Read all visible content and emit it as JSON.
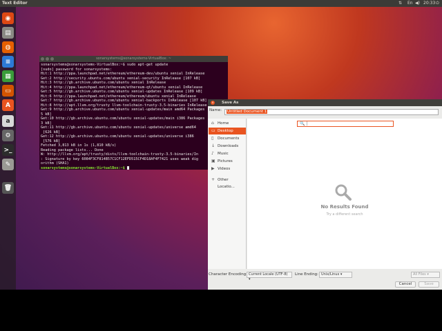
{
  "topbar": {
    "app_title": "Text Editor",
    "lang": "En",
    "time": "20:33"
  },
  "launcher": {
    "items": [
      {
        "icon": "ubuntu-dash-icon",
        "color": "#dd4814",
        "glyph": "◉"
      },
      {
        "icon": "files-icon",
        "color": "#8a8a84",
        "glyph": "▤"
      },
      {
        "icon": "firefox-icon",
        "color": "#e66000",
        "glyph": "◍"
      },
      {
        "icon": "writer-icon",
        "color": "#2c7ad6",
        "glyph": "≡"
      },
      {
        "icon": "calc-icon",
        "color": "#3a9d3a",
        "glyph": "▦"
      },
      {
        "icon": "impress-icon",
        "color": "#d35400",
        "glyph": "▭"
      },
      {
        "icon": "software-center-icon",
        "color": "#e95420",
        "glyph": "A"
      },
      {
        "icon": "amazon-icon",
        "color": "#d8d8d8",
        "glyph": "a"
      },
      {
        "icon": "settings-icon",
        "color": "#666",
        "glyph": "⚙"
      },
      {
        "icon": "terminal-icon",
        "color": "#2c2c2c",
        "glyph": ">_"
      },
      {
        "icon": "text-editor-icon",
        "color": "#9a9a94",
        "glyph": "✎"
      },
      {
        "icon": "trash-icon",
        "color": "#555",
        "glyph": "🗑"
      }
    ]
  },
  "terminal": {
    "title": "sonarsystems@sonarsystems-VirtualBox: ~",
    "lines": [
      "sonarsystems@sonarsystems-VirtualBox:~$ sudo apt-get update",
      "[sudo] password for sonarsystems:",
      "Hit:1 http://ppa.launchpad.net/ethereum/ethereum-dev/ubuntu xenial InRelease",
      "Get:2 http://security.ubuntu.com/ubuntu xenial-security InRelease [107 kB]",
      "Hit:3 http://gb.archive.ubuntu.com/ubuntu xenial InRelease",
      "Hit:4 http://ppa.launchpad.net/ethereum/ethereum-qt/ubuntu xenial InRelease",
      "Get:5 http://gb.archive.ubuntu.com/ubuntu xenial-updates InRelease [109 kB]",
      "Hit:6 http://ppa.launchpad.net/ethereum/ethereum/ubuntu xenial InRelease",
      "Get:7 http://gb.archive.ubuntu.com/ubuntu xenial-backports InRelease [107 kB]",
      "Hit:8 http://apt.llvm.org/trusty llvm-toolchain-trusty-3.5-binaries InRelease",
      "Get:9 http://gb.archive.ubuntu.com/ubuntu xenial-updates/main amd64 Packages",
      "5 kB]",
      "Get:10 http://gb.archive.ubuntu.com/ubuntu xenial-updates/main i386 Packages",
      "3 kB]",
      "Get:11 http://gb.archive.ubuntu.com/ubuntu xenial-updates/universe amd64",
      " [626 kB]",
      "Get:12 http://gb.archive.ubuntu.com/ubuntu xenial-updates/universe i386",
      " [576 kB]",
      "Fetched 3,813 kB in 1s (1,810 kB/s)",
      "Reading package lists... Done",
      "W: http://llvm.org/apt/trusty/dists/llvm-toolchain-trusty-3.5-binaries/In",
      ": Signature by key 6084F3CF814B57C1CF12EFD515CF4D18AF4F7421 uses weak dig",
      "orithm (SHA1)"
    ],
    "prompt": "sonarsystems@sonarsystems-VirtualBox:~$ "
  },
  "dialog": {
    "title": "Save As",
    "name_label": "Name:",
    "filename": "Untitled Document 1",
    "places": [
      {
        "label": "Home",
        "icon": "home-icon",
        "glyph": "⌂",
        "selected": false
      },
      {
        "label": "Desktop",
        "icon": "desktop-icon",
        "glyph": "▭",
        "selected": true
      },
      {
        "label": "Documents",
        "icon": "documents-icon",
        "glyph": "▯",
        "selected": false
      },
      {
        "label": "Downloads",
        "icon": "downloads-icon",
        "glyph": "↓",
        "selected": false
      },
      {
        "label": "Music",
        "icon": "music-icon",
        "glyph": "♪",
        "selected": false
      },
      {
        "label": "Pictures",
        "icon": "pictures-icon",
        "glyph": "▣",
        "selected": false
      },
      {
        "label": "Videos",
        "icon": "videos-icon",
        "glyph": "▶",
        "selected": false
      },
      {
        "label": "Other Locatio...",
        "icon": "plus-icon",
        "glyph": "+",
        "selected": false
      }
    ],
    "no_results": "No Results Found",
    "try_search": "Try a different search",
    "encoding_label": "Character Encoding:",
    "encoding_value": "Current Locale (UTF-8)",
    "line_ending_label": "Line Ending:",
    "line_ending_value": "Unix/Linux",
    "filter_value": "All Files",
    "cancel_label": "Cancel",
    "save_label": "Save"
  },
  "colors": {
    "accent": "#e95420",
    "terminal_bg": "#2c001e",
    "prompt": "#8ae234"
  }
}
